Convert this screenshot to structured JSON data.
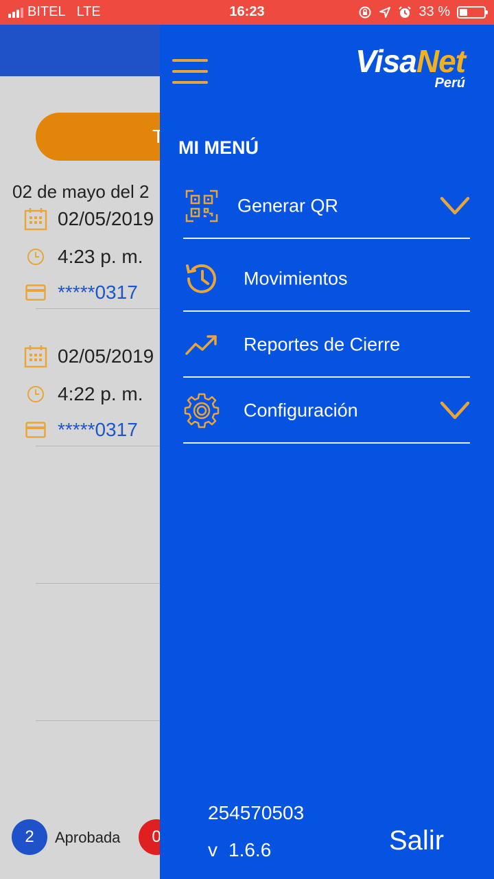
{
  "status_bar": {
    "carrier": "BITEL",
    "network": "LTE",
    "time": "16:23",
    "battery": "33 %",
    "battery_level": 0.33
  },
  "background": {
    "date_heading": "02 de mayo del 2",
    "pill_text": "T",
    "transactions": [
      {
        "date": "02/05/2019",
        "time": "4:23 p. m.",
        "card": "*****0317"
      },
      {
        "date": "02/05/2019",
        "time": "4:22 p. m.",
        "card": "*****0317"
      }
    ],
    "footer": {
      "approved_count": "2",
      "approved_label": "Aprobada",
      "rejected_count": "0"
    }
  },
  "drawer": {
    "logo": {
      "brand_part1": "Visa",
      "brand_part2": "Net",
      "country": "Perú"
    },
    "menu_title": "MI MENÚ",
    "items": [
      {
        "label": "Generar QR",
        "icon": "qr-code-icon",
        "has_chevron": true
      },
      {
        "label": "Movimientos",
        "icon": "history-icon",
        "has_chevron": false
      },
      {
        "label": "Reportes de Cierre",
        "icon": "trend-up-icon",
        "has_chevron": false
      },
      {
        "label": "Configuración",
        "icon": "gear-icon",
        "has_chevron": true
      }
    ],
    "account_number": "254570503",
    "version_prefix": "v",
    "version": "1.6.6",
    "logout_label": "Salir"
  },
  "colors": {
    "drawer_bg": "#0653e1",
    "accent": "#e8a53a",
    "status_bar": "#ee4a3f",
    "pill": "#e2850a",
    "card_text": "#1c56c8"
  }
}
